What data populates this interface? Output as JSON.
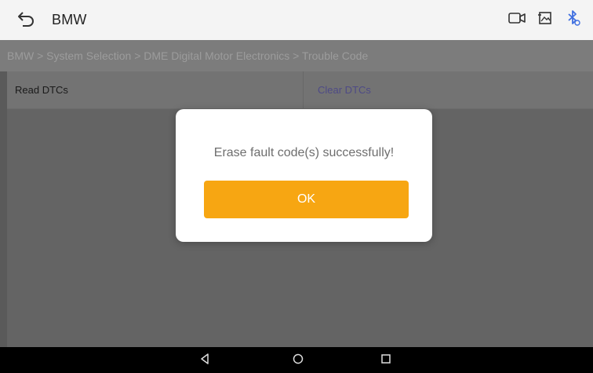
{
  "header": {
    "title": "BMW",
    "back_icon": "back-arrow-icon",
    "actions": [
      {
        "name": "video-record-icon"
      },
      {
        "name": "screenshot-icon"
      },
      {
        "name": "bluetooth-icon",
        "color": "#3f6fe0"
      }
    ]
  },
  "breadcrumb": {
    "text": "BMW > System Selection > DME Digital Motor Electronics > Trouble Code"
  },
  "functions": {
    "read_label": "Read DTCs",
    "clear_label": "Clear DTCs"
  },
  "dialog": {
    "message": "Erase fault code(s) successfully!",
    "ok_label": "OK",
    "ok_color": "#f7a612"
  },
  "navbar": {
    "buttons": [
      "back-triangle-icon",
      "home-circle-icon",
      "recents-square-icon"
    ]
  }
}
